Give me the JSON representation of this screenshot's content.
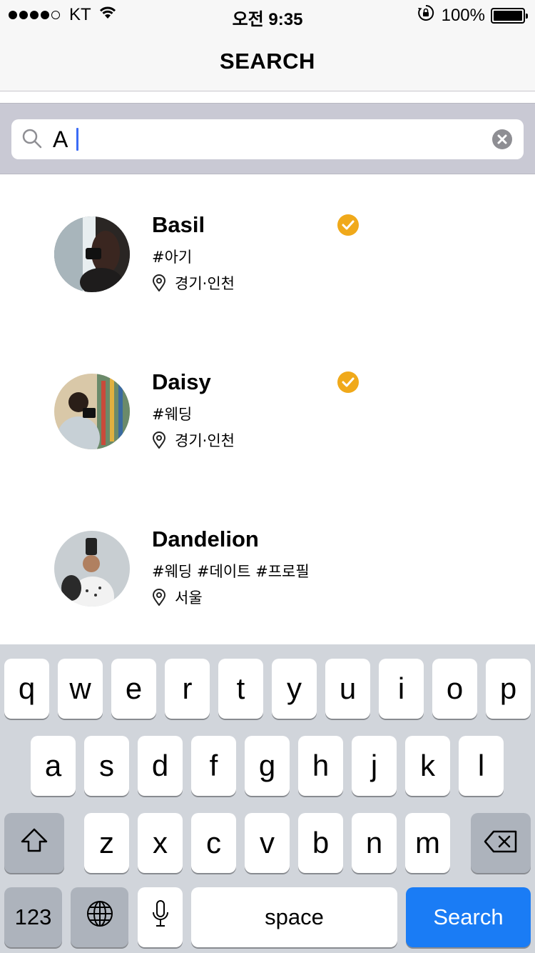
{
  "status_bar": {
    "carrier": "KT",
    "time": "오전 9:35",
    "battery": "100%"
  },
  "nav": {
    "title": "SEARCH"
  },
  "search": {
    "value": "A",
    "placeholder": ""
  },
  "results": [
    {
      "name": "Basil",
      "tags": "#아기",
      "location": "경기·인천",
      "verified": true
    },
    {
      "name": "Daisy",
      "tags": "#웨딩",
      "location": "경기·인천",
      "verified": true
    },
    {
      "name": "Dandelion",
      "tags": "#웨딩 #데이트 #프로필",
      "location": "서울",
      "verified": false
    }
  ],
  "keyboard": {
    "row1": [
      "q",
      "w",
      "e",
      "r",
      "t",
      "y",
      "u",
      "i",
      "o",
      "p"
    ],
    "row2": [
      "a",
      "s",
      "d",
      "f",
      "g",
      "h",
      "j",
      "k",
      "l"
    ],
    "row3": [
      "z",
      "x",
      "c",
      "v",
      "b",
      "n",
      "m"
    ],
    "numbers_label": "123",
    "space_label": "space",
    "search_label": "Search"
  },
  "colors": {
    "verified": "#f0a91a",
    "search_key": "#1a7cf5",
    "caret": "#3b6cf6"
  }
}
